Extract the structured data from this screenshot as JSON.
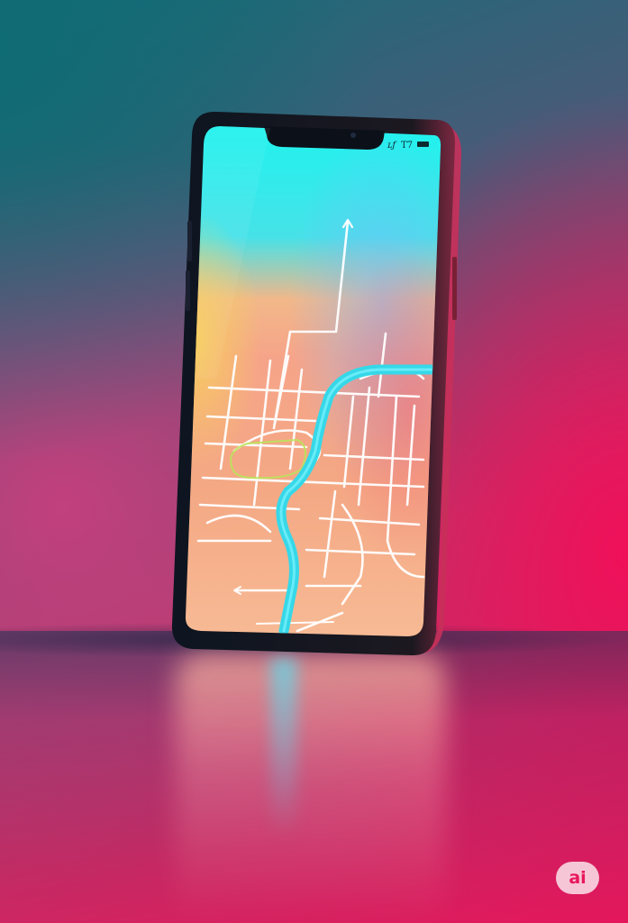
{
  "scene": {
    "status_bar": {
      "signal_text": "ʟƒ",
      "network_text": "T7"
    },
    "watermark": {
      "text": "ai"
    }
  }
}
